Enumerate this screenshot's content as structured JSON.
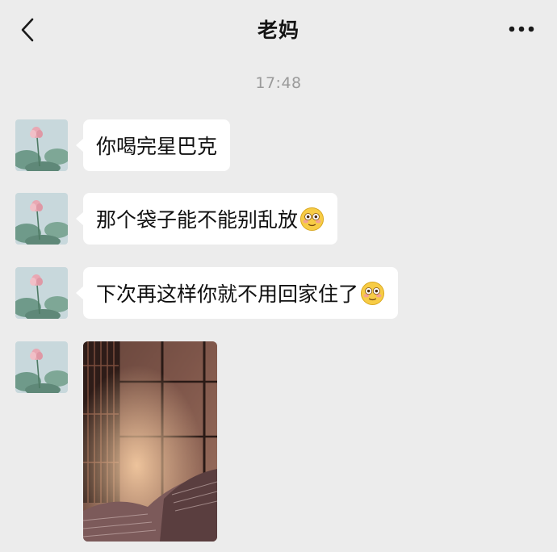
{
  "header": {
    "title": "老妈",
    "back_icon": "chevron-left-icon",
    "more_icon": "more-dots-icon"
  },
  "chat": {
    "timestamp": "17:48",
    "messages": [
      {
        "sender": "老妈",
        "text": "你喝完星巴克",
        "emoji": ""
      },
      {
        "sender": "老妈",
        "text": "那个袋子能不能别乱放",
        "emoji": "flushed-face-emoji"
      },
      {
        "sender": "老妈",
        "text": "下次再这样你就不用回家住了",
        "emoji": "flushed-face-emoji"
      },
      {
        "sender": "老妈",
        "type": "image",
        "image": "room-photo"
      }
    ]
  },
  "colors": {
    "background": "#ececec",
    "bubble": "#ffffff",
    "timestamp": "#9a9a9a"
  }
}
